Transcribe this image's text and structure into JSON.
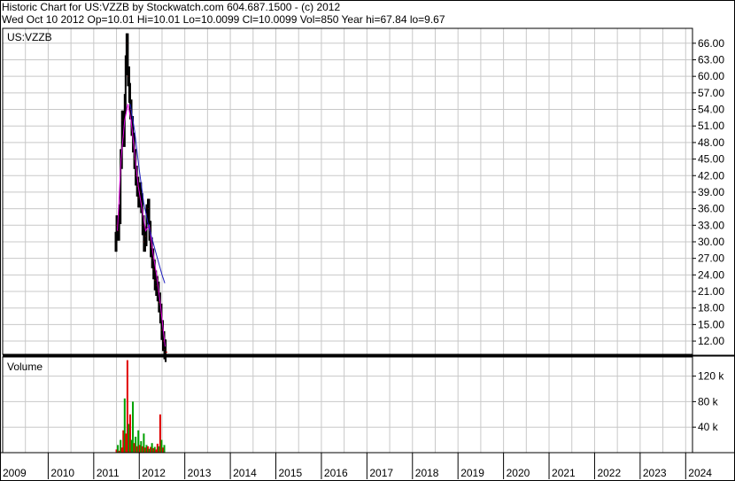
{
  "header": {
    "line1": "Historic Chart for US:VZZB by Stockwatch.com 604.687.1500 - (c) 2012",
    "line2": "Wed Oct 10 2012   Op=10.01   Hi=10.01   Lo=10.0099   Cl=10.0099   Vol=850   Year hi=67.84   lo=9.67"
  },
  "price_panel": {
    "symbol": "US:VZZB"
  },
  "volume_panel": {
    "label": "Volume"
  },
  "colors": {
    "grid": "#c8c8c8",
    "frame": "#000000",
    "candles": "#000000",
    "ma_short": "#e000e0",
    "ma_long": "#2020c0",
    "vol_up": "#00a000",
    "vol_down": "#e00000"
  },
  "chart_data": [
    {
      "type": "line",
      "panel": "price",
      "x_ticks": [
        "2009",
        "2010",
        "2011",
        "2012",
        "2013",
        "2014",
        "2015",
        "2016",
        "2017",
        "2018",
        "2019",
        "2020",
        "2021",
        "2022",
        "2023",
        "2024"
      ],
      "xlim": [
        2009.0,
        2024.15
      ],
      "y_ticks": [
        12,
        15,
        18,
        21,
        24,
        27,
        30,
        33,
        36,
        39,
        42,
        45,
        48,
        51,
        54,
        57,
        60,
        63,
        66
      ],
      "ylim": [
        9.6,
        68.7
      ],
      "grid": true,
      "y_axis_side": "right",
      "series": [
        {
          "role": "price-bars",
          "points": [
            [
              2011.48,
              30
            ],
            [
              2011.5,
              33
            ],
            [
              2011.53,
              32
            ],
            [
              2011.56,
              35
            ],
            [
              2011.59,
              45
            ],
            [
              2011.62,
              52
            ],
            [
              2011.65,
              49
            ],
            [
              2011.68,
              55
            ],
            [
              2011.7,
              62
            ],
            [
              2011.72,
              66
            ],
            [
              2011.75,
              60
            ],
            [
              2011.78,
              57
            ],
            [
              2011.8,
              54
            ],
            [
              2011.83,
              51
            ],
            [
              2011.86,
              48
            ],
            [
              2011.89,
              45
            ],
            [
              2011.92,
              42
            ],
            [
              2011.95,
              40
            ],
            [
              2011.98,
              38
            ],
            [
              2012.01,
              39
            ],
            [
              2012.04,
              37
            ],
            [
              2012.07,
              33
            ],
            [
              2012.1,
              30
            ],
            [
              2012.13,
              31
            ],
            [
              2012.16,
              35
            ],
            [
              2012.19,
              36
            ],
            [
              2012.22,
              32
            ],
            [
              2012.25,
              29
            ],
            [
              2012.28,
              27
            ],
            [
              2012.31,
              25
            ],
            [
              2012.34,
              23
            ],
            [
              2012.37,
              22
            ],
            [
              2012.4,
              21
            ],
            [
              2012.43,
              19
            ],
            [
              2012.46,
              17
            ],
            [
              2012.49,
              14
            ],
            [
              2012.52,
              12
            ],
            [
              2012.55,
              10.5
            ],
            [
              2012.58,
              10
            ]
          ]
        },
        {
          "role": "moving-average-short",
          "points": [
            [
              2011.52,
              32
            ],
            [
              2011.6,
              45
            ],
            [
              2011.68,
              52
            ],
            [
              2011.75,
              55
            ],
            [
              2011.82,
              52
            ],
            [
              2011.9,
              46
            ],
            [
              2011.98,
              40
            ],
            [
              2012.06,
              36
            ],
            [
              2012.14,
              32
            ],
            [
              2012.22,
              33
            ],
            [
              2012.3,
              28
            ],
            [
              2012.38,
              24
            ],
            [
              2012.46,
              19
            ],
            [
              2012.54,
              13
            ],
            [
              2012.57,
              11
            ]
          ]
        },
        {
          "role": "moving-average-long",
          "points": [
            [
              2011.8,
              55
            ],
            [
              2011.9,
              50
            ],
            [
              2012.0,
              43
            ],
            [
              2012.1,
              37
            ],
            [
              2012.2,
              33
            ],
            [
              2012.3,
              30
            ],
            [
              2012.4,
              27
            ],
            [
              2012.5,
              24
            ],
            [
              2012.56,
              22.5
            ]
          ]
        }
      ]
    },
    {
      "type": "bar",
      "panel": "volume",
      "y_ticks": [
        40000,
        80000,
        120000
      ],
      "y_tick_labels": [
        "40 k",
        "80 k",
        "120 k"
      ],
      "ylim": [
        0,
        150000
      ],
      "grid": true,
      "bars": [
        [
          2011.5,
          5000,
          "down"
        ],
        [
          2011.53,
          12000,
          "up"
        ],
        [
          2011.56,
          3000,
          "down"
        ],
        [
          2011.59,
          20000,
          "up"
        ],
        [
          2011.62,
          8000,
          "down"
        ],
        [
          2011.65,
          35000,
          "down"
        ],
        [
          2011.68,
          85000,
          "up"
        ],
        [
          2011.71,
          30000,
          "down"
        ],
        [
          2011.74,
          145000,
          "down"
        ],
        [
          2011.77,
          45000,
          "up"
        ],
        [
          2011.8,
          60000,
          "down"
        ],
        [
          2011.83,
          20000,
          "up"
        ],
        [
          2011.86,
          80000,
          "up"
        ],
        [
          2011.89,
          15000,
          "down"
        ],
        [
          2011.92,
          25000,
          "up"
        ],
        [
          2011.95,
          10000,
          "down"
        ],
        [
          2011.98,
          35000,
          "up"
        ],
        [
          2012.01,
          12000,
          "down"
        ],
        [
          2012.04,
          18000,
          "up"
        ],
        [
          2012.07,
          10000,
          "down"
        ],
        [
          2012.1,
          30000,
          "up"
        ],
        [
          2012.13,
          8000,
          "down"
        ],
        [
          2012.16,
          12000,
          "up"
        ],
        [
          2012.19,
          10000,
          "down"
        ],
        [
          2012.22,
          6000,
          "up"
        ],
        [
          2012.25,
          9000,
          "down"
        ],
        [
          2012.28,
          15000,
          "up"
        ],
        [
          2012.31,
          7000,
          "down"
        ],
        [
          2012.34,
          9000,
          "up"
        ],
        [
          2012.37,
          5000,
          "down"
        ],
        [
          2012.4,
          14000,
          "down"
        ],
        [
          2012.43,
          10000,
          "up"
        ],
        [
          2012.46,
          60000,
          "down"
        ],
        [
          2012.49,
          20000,
          "up"
        ],
        [
          2012.52,
          8000,
          "down"
        ],
        [
          2012.55,
          12000,
          "up"
        ]
      ]
    }
  ]
}
